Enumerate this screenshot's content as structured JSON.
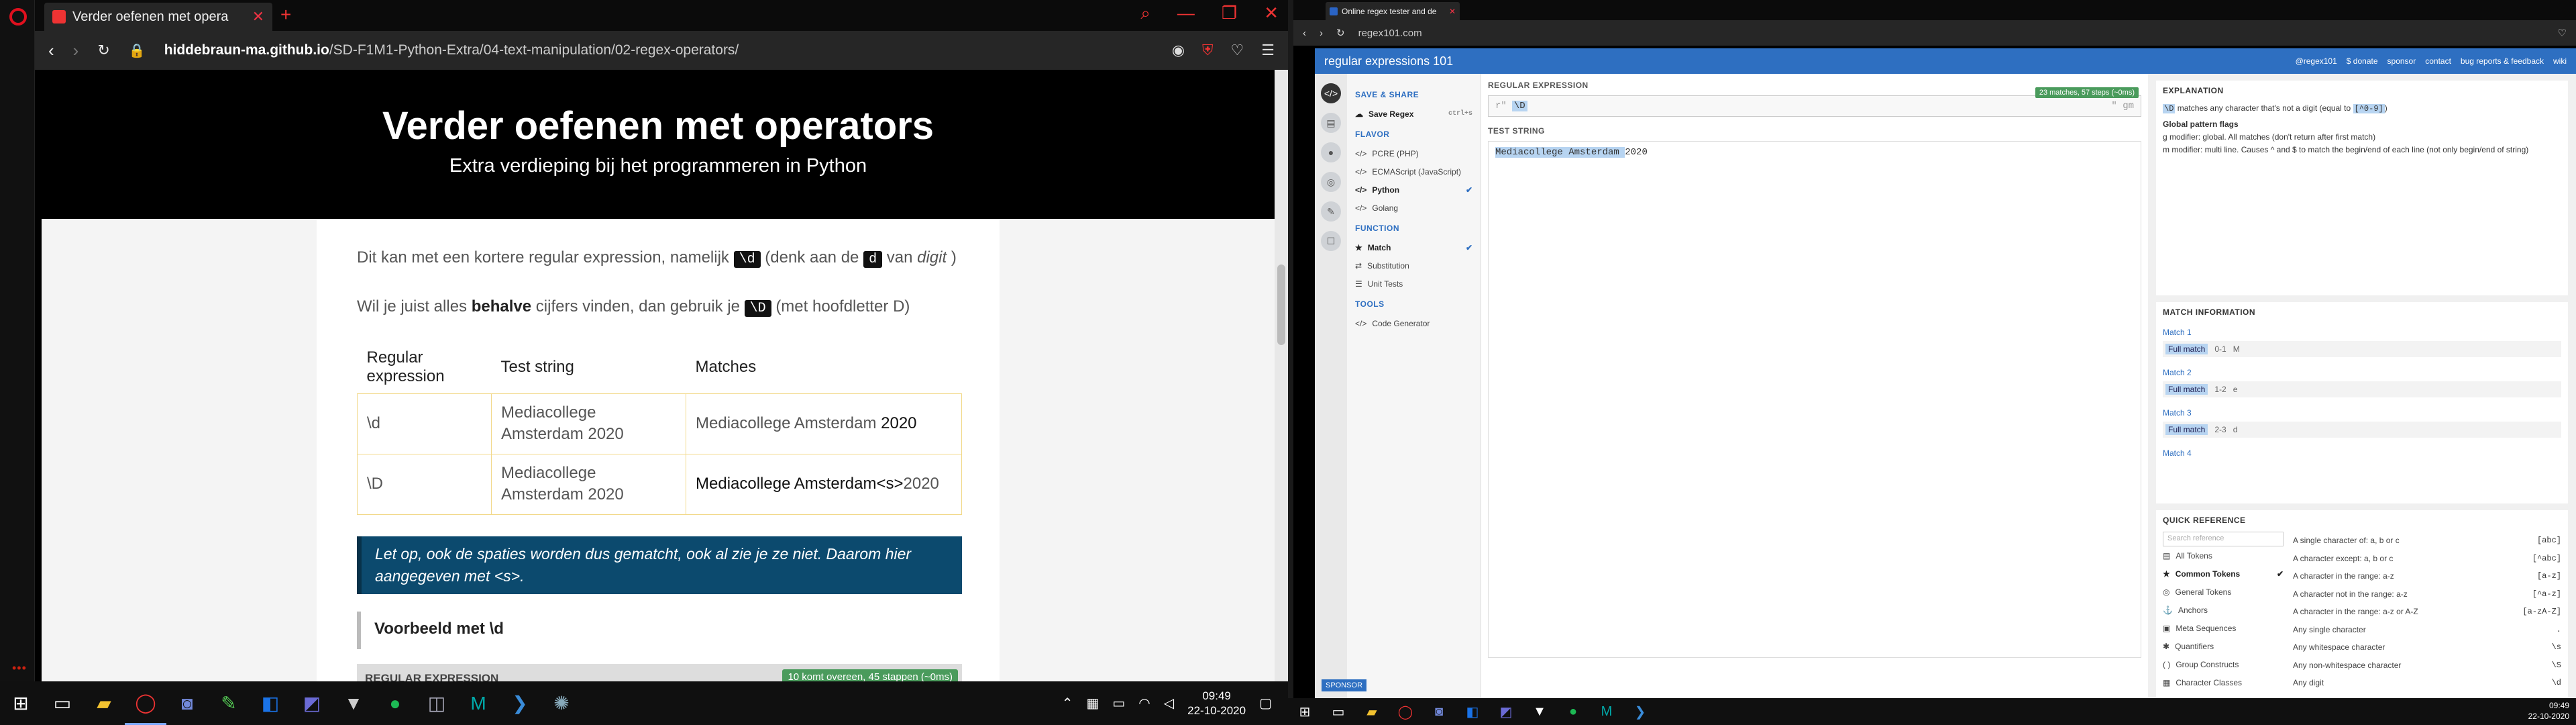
{
  "browser_left": {
    "tab_title": "Verder oefenen met opera",
    "url_host": "hiddebraun-ma.github.io",
    "url_path": "/SD-F1M1-Python-Extra/04-text-manipulation/02-regex-operators/",
    "colors": {
      "accent": "#e0101e"
    }
  },
  "page": {
    "title": "Verder oefenen met operators",
    "subtitle": "Extra verdieping bij het programmeren in Python",
    "para1_a": "Dit kan met een kortere regular expression, namelijk",
    "para1_code": "\\d",
    "para1_b": "(denk aan de",
    "para1_code2": "d",
    "para1_c": "van",
    "para1_em": "digit",
    "para1_d": ")",
    "para2_a": "Wil je juist alles",
    "para2_bold": "behalve",
    "para2_b": "cijfers vinden, dan gebruik je",
    "para2_code": "\\D",
    "para2_c": "(met hoofdletter D)",
    "table": {
      "headers": [
        "Regular expression",
        "Test string",
        "Matches"
      ],
      "rows": [
        {
          "re": "\\d",
          "test": "Mediacollege Amsterdam 2020",
          "match_pre": "Mediacollege Amsterdam ",
          "match_hl": "2020",
          "match_post": ""
        },
        {
          "re": "\\D",
          "test": "Mediacollege Amsterdam 2020",
          "match_pre": "",
          "match_hl": "Mediacollege Amsterdam<s>",
          "match_post": "2020"
        }
      ]
    },
    "note": "Let op, ook de spaties worden dus gematcht, ook al zie je ze niet. Daarom hier aangegeven met <s>.",
    "example_heading": "Voorbeeld met \\d",
    "strip_label": "REGULAR EXPRESSION",
    "strip_badge": "10 komt overeen, 45 stappen (~0ms)"
  },
  "taskbar": {
    "time": "09:49",
    "date": "22-10-2020"
  },
  "browser_right": {
    "tab_title": "Online regex tester and de",
    "url": "regex101.com"
  },
  "regex101": {
    "logo": "regular expressions 101",
    "top_links": [
      "@regex101",
      "$ donate",
      "sponsor",
      "contact",
      "bug reports & feedback",
      "wiki"
    ],
    "sections": {
      "save": "SAVE & SHARE",
      "save_item": "Save Regex",
      "save_shortcut": "ctrl+s",
      "flavor": "FLAVOR",
      "flavors": [
        "PCRE (PHP)",
        "ECMAScript (JavaScript)",
        "Python",
        "Golang"
      ],
      "function": "FUNCTION",
      "functions": [
        "Match",
        "Substitution",
        "Unit Tests"
      ],
      "tools": "TOOLS",
      "tool_item": "Code Generator"
    },
    "regex_label": "REGULAR EXPRESSION",
    "regex_badge": "23 matches, 57 steps (~0ms)",
    "regex_prefix": "r\"",
    "regex_value": "\\D",
    "regex_flags": "\" gm",
    "test_label": "TEST STRING",
    "test_matched": "Mediacollege Amsterdam ",
    "test_rest": "2020",
    "explanation_title": "EXPLANATION",
    "exp_line1": "\\D",
    "exp_line1b": "matches any character that's not a digit (equal to",
    "exp_line1c": "[^0-9]",
    "exp_flags": "Global pattern flags",
    "exp_g": "g modifier: global. All matches (don't return after first match)",
    "exp_m": "m modifier: multi line. Causes ^ and $ to match the begin/end of each line (not only begin/end of string)",
    "match_info_title": "MATCH INFORMATION",
    "matches": [
      {
        "title": "Match 1",
        "range": "0-1",
        "value": "M"
      },
      {
        "title": "Match 2",
        "range": "1-2",
        "value": "e"
      },
      {
        "title": "Match 3",
        "range": "2-3",
        "value": "d"
      },
      {
        "title": "Match 4",
        "range": "",
        "value": ""
      }
    ],
    "full_match": "Full match",
    "quickref_title": "QUICK REFERENCE",
    "search_placeholder": "Search reference",
    "categories": [
      "All Tokens",
      "Common Tokens",
      "General Tokens",
      "Anchors",
      "Meta Sequences",
      "Quantifiers",
      "Group Constructs",
      "Character Classes"
    ],
    "refs": [
      {
        "d": "A single character of: a, b or c",
        "t": "[abc]"
      },
      {
        "d": "A character except: a, b or c",
        "t": "[^abc]"
      },
      {
        "d": "A character in the range: a-z",
        "t": "[a-z]"
      },
      {
        "d": "A character not in the range: a-z",
        "t": "[^a-z]"
      },
      {
        "d": "A character in the range: a-z or A-Z",
        "t": "[a-zA-Z]"
      },
      {
        "d": "Any single character",
        "t": "."
      },
      {
        "d": "Any whitespace character",
        "t": "\\s"
      },
      {
        "d": "Any non-whitespace character",
        "t": "\\S"
      },
      {
        "d": "Any digit",
        "t": "\\d"
      }
    ],
    "sponsor": "SPONSOR",
    "time": "09:49",
    "date": "22-10-2020"
  }
}
